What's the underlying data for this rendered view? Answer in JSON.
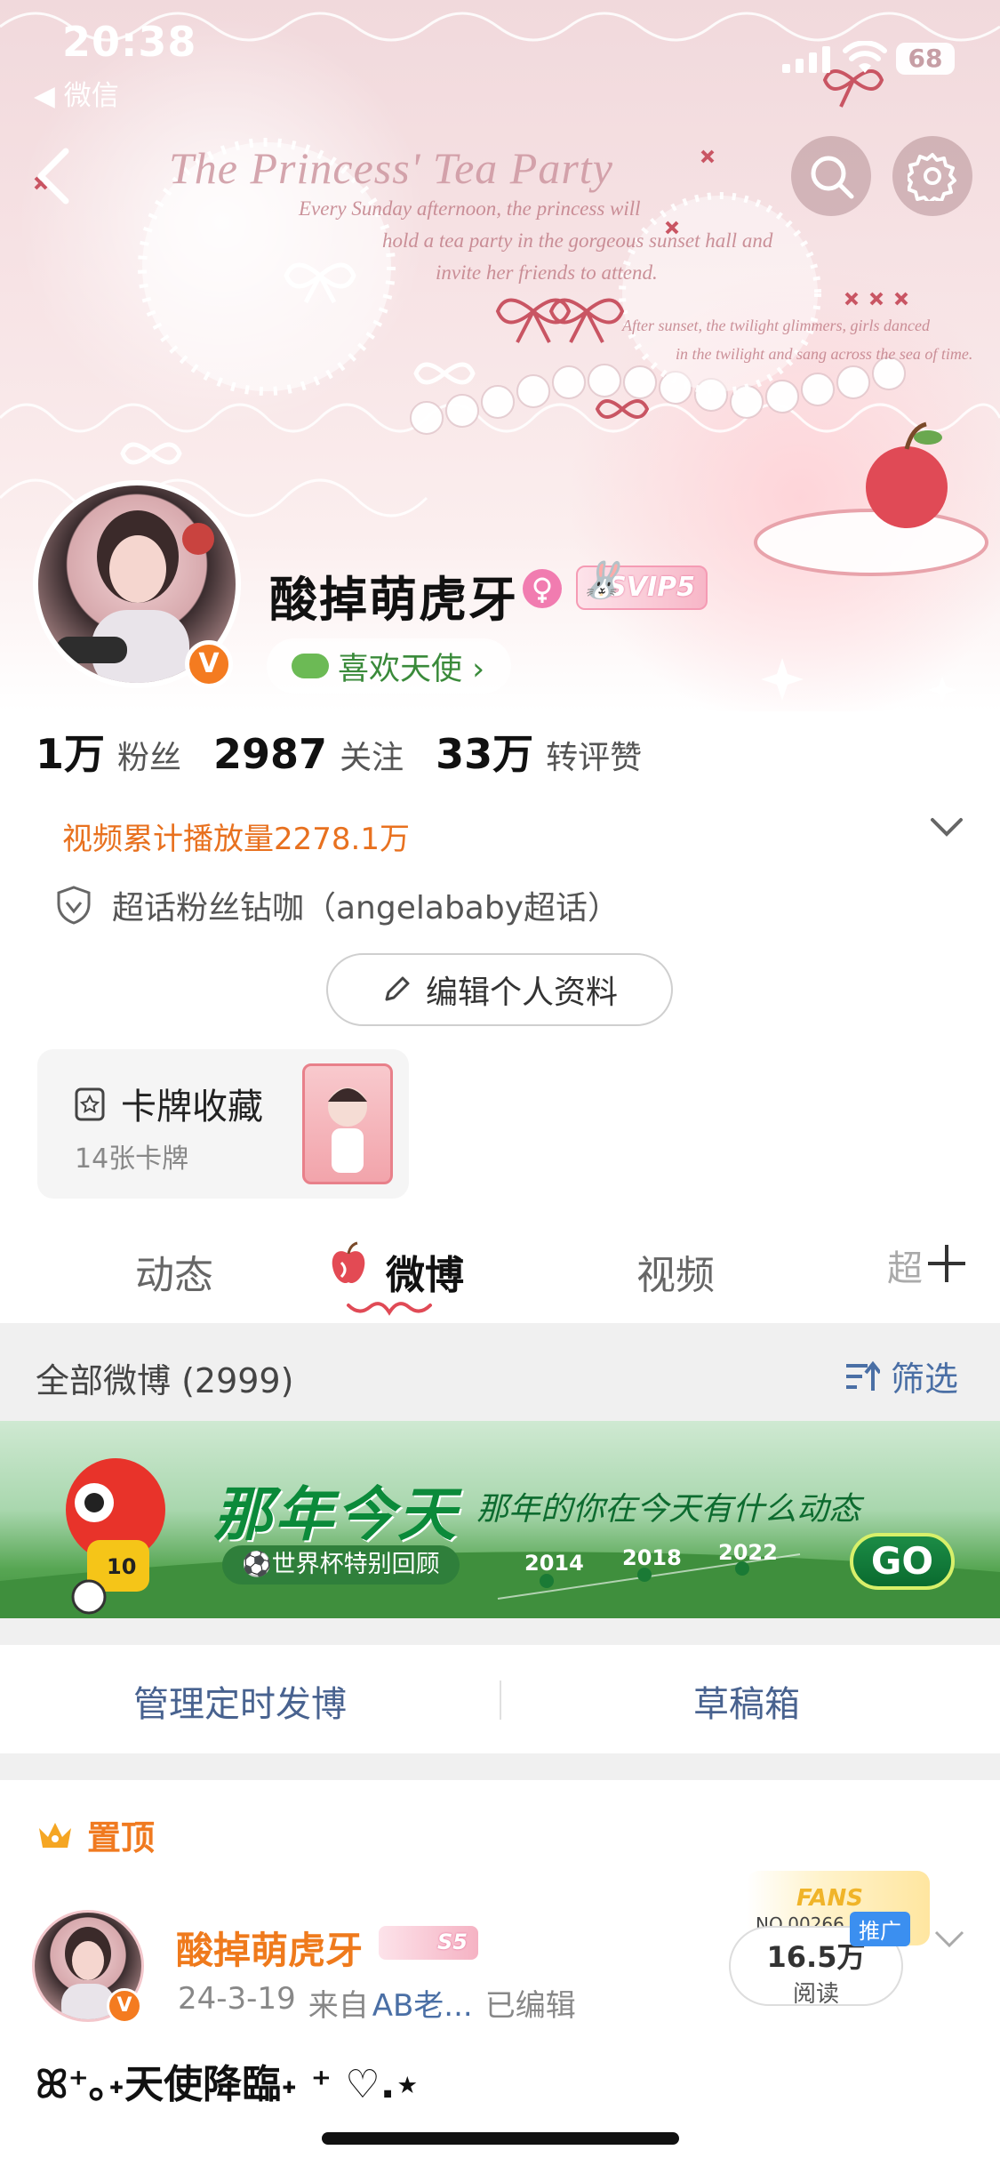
{
  "status_bar": {
    "time": "20:38",
    "back_app": "◀ 微信",
    "battery": "68"
  },
  "cover": {
    "title": "The Princess' Tea Party",
    "lines": [
      "Every Sunday afternoon, the princess will",
      "hold a tea party in the gorgeous sunset hall and",
      "invite her friends to attend.",
      "After sunset, the twilight glimmers, girls danced",
      "in the twilight and sang across the sea of time."
    ]
  },
  "profile": {
    "nickname": "酸掉萌虎牙",
    "svip": "SVIP5",
    "fan_tag": "喜欢天使 ›",
    "v_badge": "V",
    "stats": [
      {
        "num": "1万",
        "label": "粉丝"
      },
      {
        "num": "2987",
        "label": "关注"
      },
      {
        "num": "33万",
        "label": "转评赞"
      }
    ],
    "play_count": "视频累计播放量2278.1万",
    "super_topic": "超话粉丝钻咖（angelababy超话）",
    "edit_button": "编辑个人资料",
    "cards": {
      "title": "卡牌收藏",
      "count": "14张卡牌"
    }
  },
  "tabs": [
    {
      "label": "动态",
      "active": false
    },
    {
      "label": "微博",
      "active": true
    },
    {
      "label": "视频",
      "active": false
    },
    {
      "label": "超",
      "active": false
    }
  ],
  "feed_header": {
    "all": "全部微博 (2999)",
    "filter": "筛选"
  },
  "banner": {
    "title": "那年今天",
    "subtitle": "那年的你在今天有什么动态",
    "chip": "⚽世界杯特别回顾",
    "years": [
      "2014",
      "2018",
      "2022"
    ],
    "go": "GO",
    "mascot_number": "10"
  },
  "manage": {
    "scheduled": "管理定时发博",
    "drafts": "草稿箱"
  },
  "post": {
    "pinned": "置顶",
    "author": "酸掉萌虎牙",
    "level": "S5",
    "date": "24-3-19",
    "source_prefix": "来自",
    "source": "AB老...",
    "edited": "已编辑",
    "fans_label": "FANS",
    "fans_no": "NO.00266",
    "promo": "推广",
    "reads": "16.5万",
    "reads_label": "阅读",
    "text": "ꕤ⁺｡˖天使降臨˖ ⁺ ♡.⋆"
  },
  "colors": {
    "accent_orange": "#f07a20",
    "link_blue": "#4a6fa5",
    "svip_pink": "#f59bb4"
  }
}
